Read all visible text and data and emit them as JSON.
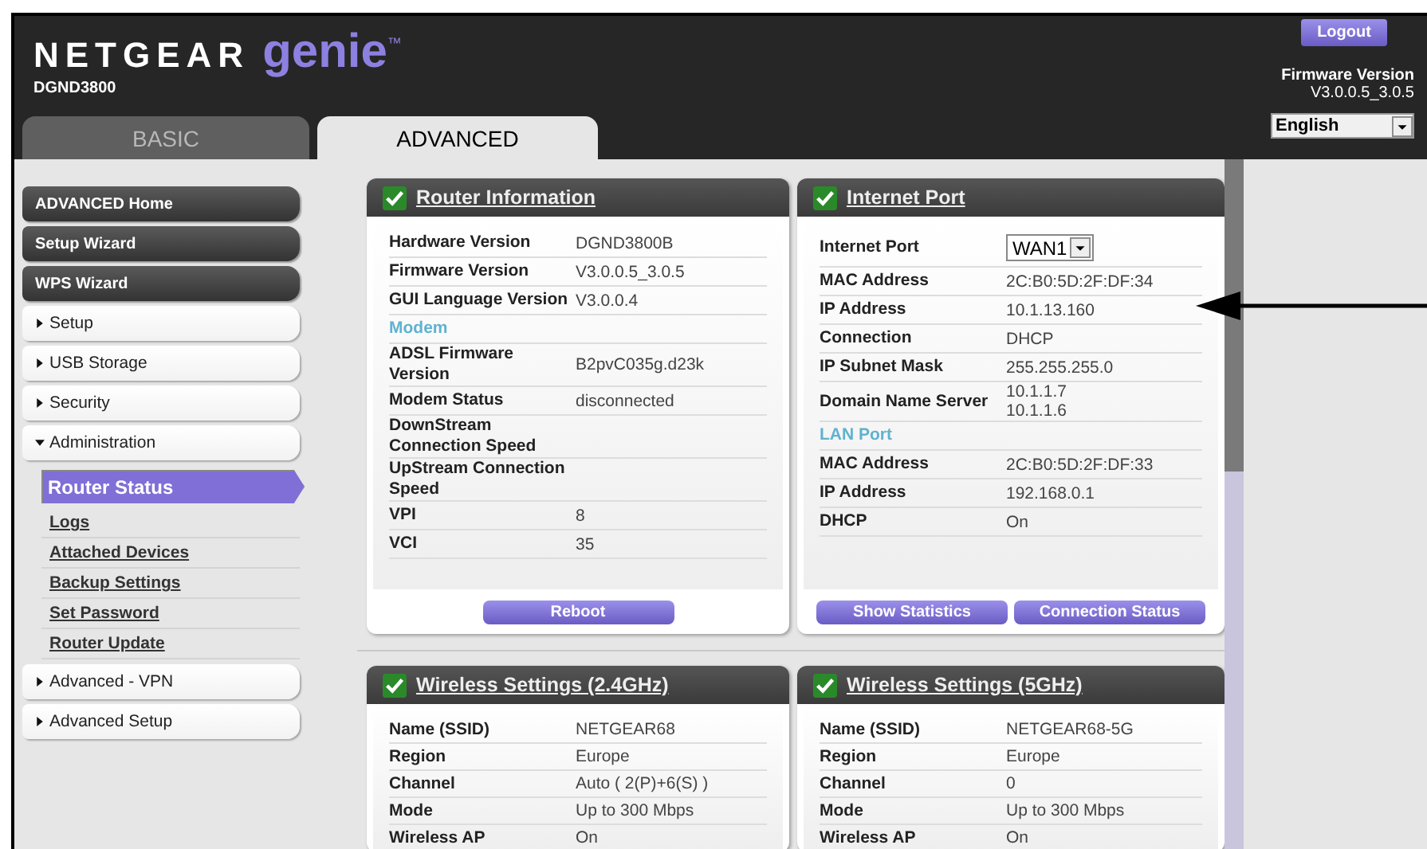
{
  "header": {
    "brand": "NETGEAR",
    "product": "genie",
    "trademark": "™",
    "model": "DGND3800",
    "logout": "Logout",
    "firmware_label": "Firmware Version",
    "firmware_value": "V3.0.0.5_3.0.5",
    "language": "English"
  },
  "tabs": [
    {
      "label": "BASIC",
      "selected": false
    },
    {
      "label": "ADVANCED",
      "selected": true
    }
  ],
  "sidebar": {
    "items": [
      {
        "kind": "button",
        "label": "ADVANCED Home"
      },
      {
        "kind": "button",
        "label": "Setup Wizard"
      },
      {
        "kind": "button",
        "label": "WPS Wizard"
      },
      {
        "kind": "section",
        "label": "Setup",
        "expanded": false
      },
      {
        "kind": "section",
        "label": "USB Storage",
        "expanded": false
      },
      {
        "kind": "section",
        "label": "Security",
        "expanded": false
      },
      {
        "kind": "section",
        "label": "Administration",
        "expanded": true,
        "children": [
          {
            "label": "Router Status",
            "selected": true
          },
          {
            "label": "Logs",
            "selected": false
          },
          {
            "label": "Attached Devices",
            "selected": false
          },
          {
            "label": "Backup Settings",
            "selected": false
          },
          {
            "label": "Set Password",
            "selected": false
          },
          {
            "label": "Router Update",
            "selected": false
          }
        ]
      },
      {
        "kind": "section",
        "label": "Advanced - VPN",
        "expanded": false
      },
      {
        "kind": "section",
        "label": "Advanced Setup",
        "expanded": false
      }
    ]
  },
  "panels": [
    {
      "title": "Router Information",
      "ok": true,
      "rows": [
        {
          "kind": "row",
          "label": "Hardware Version",
          "value": "DGND3800B"
        },
        {
          "kind": "row",
          "label": "Firmware Version",
          "value": "V3.0.0.5_3.0.5"
        },
        {
          "kind": "row",
          "label": "GUI Language Version",
          "value": "V3.0.0.4"
        },
        {
          "kind": "section",
          "label": "Modem"
        },
        {
          "kind": "row",
          "label": "ADSL Firmware Version",
          "value": "B2pvC035g.d23k"
        },
        {
          "kind": "row",
          "label": "Modem Status",
          "value": "disconnected"
        },
        {
          "kind": "row",
          "label": "DownStream Connection Speed"
        },
        {
          "kind": "row",
          "label": "UpStream Connection Speed"
        },
        {
          "kind": "row",
          "label": "VPI",
          "value": "8"
        },
        {
          "kind": "row",
          "label": "VCI",
          "value": "35"
        }
      ],
      "buttons": [
        "Reboot"
      ]
    },
    {
      "title": "Internet Port",
      "ok": true,
      "rows": [
        {
          "kind": "select",
          "label": "Internet Port",
          "value": "WAN1"
        },
        {
          "kind": "row",
          "label": "MAC Address",
          "value": "2C:B0:5D:2F:DF:34"
        },
        {
          "kind": "row",
          "label": "IP Address",
          "value": "10.1.13.160"
        },
        {
          "kind": "row",
          "label": "Connection",
          "value": "DHCP"
        },
        {
          "kind": "row",
          "label": "IP Subnet Mask",
          "value": "255.255.255.0"
        },
        {
          "kind": "row",
          "label": "Domain Name Server",
          "value": "10.1.1.7\n10.1.1.6"
        },
        {
          "kind": "section",
          "label": "LAN Port"
        },
        {
          "kind": "row",
          "label": "MAC Address",
          "value": "2C:B0:5D:2F:DF:33"
        },
        {
          "kind": "row",
          "label": "IP Address",
          "value": "192.168.0.1"
        },
        {
          "kind": "row",
          "label": "DHCP",
          "value": "On"
        }
      ],
      "buttons": [
        "Show Statistics",
        "Connection Status"
      ]
    },
    {
      "title": "Wireless Settings (2.4GHz)",
      "ok": true,
      "rows": [
        {
          "label": "Name (SSID)",
          "value": "NETGEAR68"
        },
        {
          "label": "Region",
          "value": "Europe"
        },
        {
          "label": "Channel",
          "value": "Auto ( 2(P)+6(S) )"
        },
        {
          "label": "Mode",
          "value": "Up to 300 Mbps"
        },
        {
          "label": "Wireless AP",
          "value": "On"
        }
      ]
    },
    {
      "title": "Wireless Settings (5GHz)",
      "ok": true,
      "rows": [
        {
          "label": "Name (SSID)",
          "value": "NETGEAR68-5G"
        },
        {
          "label": "Region",
          "value": "Europe"
        },
        {
          "label": "Channel",
          "value": "0"
        },
        {
          "label": "Mode",
          "value": "Up to 300 Mbps"
        },
        {
          "label": "Wireless AP",
          "value": "On"
        }
      ]
    }
  ]
}
